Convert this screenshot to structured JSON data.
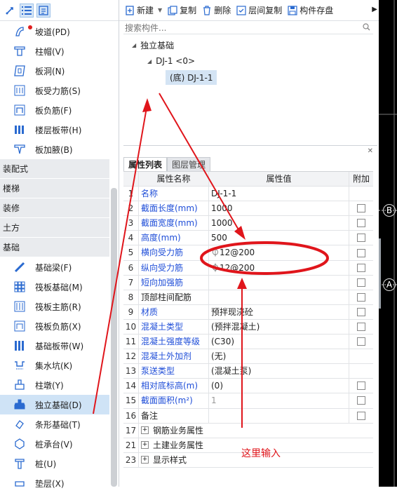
{
  "left_panel": {
    "items_top": [
      {
        "label": "坡道(PD)",
        "icon": "ramp-icon"
      },
      {
        "label": "柱帽(V)",
        "icon": "column-cap-icon"
      },
      {
        "label": "板洞(N)",
        "icon": "slab-hole-icon"
      },
      {
        "label": "板受力筋(S)",
        "icon": "slab-rebar-icon"
      },
      {
        "label": "板负筋(F)",
        "icon": "slab-negative-rebar-icon"
      },
      {
        "label": "楼层板带(H)",
        "icon": "floor-slab-strip-icon"
      },
      {
        "label": "板加腋(B)",
        "icon": "slab-haunch-icon"
      }
    ],
    "categories": [
      "装配式",
      "楼梯",
      "装修",
      "土方",
      "基础"
    ],
    "items_bottom": [
      {
        "label": "基础梁(F)",
        "icon": "foundation-beam-icon"
      },
      {
        "label": "筏板基础(M)",
        "icon": "raft-foundation-icon"
      },
      {
        "label": "筏板主筋(R)",
        "icon": "raft-main-rebar-icon"
      },
      {
        "label": "筏板负筋(X)",
        "icon": "raft-negative-rebar-icon"
      },
      {
        "label": "基础板带(W)",
        "icon": "foundation-strip-icon"
      },
      {
        "label": "集水坑(K)",
        "icon": "sump-pit-icon"
      },
      {
        "label": "柱墩(Y)",
        "icon": "column-pier-icon"
      },
      {
        "label": "独立基础(D)",
        "icon": "isolated-footing-icon",
        "selected": true
      },
      {
        "label": "条形基础(T)",
        "icon": "strip-footing-icon"
      },
      {
        "label": "桩承台(V)",
        "icon": "pile-cap-icon"
      },
      {
        "label": "桩(U)",
        "icon": "pile-icon"
      },
      {
        "label": "垫层(X)",
        "icon": "cushion-icon"
      }
    ]
  },
  "toolbar": {
    "new_label": "新建",
    "copy_label": "复制",
    "delete_label": "删除",
    "floor_copy_label": "层间复制",
    "store_label": "构件存盘"
  },
  "search": {
    "placeholder": "搜索构件..."
  },
  "tree": {
    "root": "独立基础",
    "child": "DJ-1 <0>",
    "leaf": "(底) DJ-1-1"
  },
  "props": {
    "tabs": [
      "属性列表",
      "图层管理"
    ],
    "headers": {
      "name": "属性名称",
      "value": "属性值",
      "extra": "附加"
    },
    "rows": [
      {
        "n": "1",
        "name": "名称",
        "value": "DJ-1-1",
        "blue": true,
        "check": false
      },
      {
        "n": "2",
        "name": "截面长度(mm)",
        "value": "1000",
        "blue": true,
        "check": true
      },
      {
        "n": "3",
        "name": "截面宽度(mm)",
        "value": "1000",
        "blue": true,
        "check": true
      },
      {
        "n": "4",
        "name": "高度(mm)",
        "value": "500",
        "blue": true,
        "check": true
      },
      {
        "n": "5",
        "name": "横向受力筋",
        "value": "⏀12@200",
        "blue": true,
        "check": true
      },
      {
        "n": "6",
        "name": "纵向受力筋",
        "value": "⏀12@200",
        "blue": true,
        "check": true
      },
      {
        "n": "7",
        "name": "短向加强筋",
        "value": "",
        "blue": true,
        "check": true
      },
      {
        "n": "8",
        "name": "顶部柱间配筋",
        "value": "",
        "blue": false,
        "check": true
      },
      {
        "n": "9",
        "name": "材质",
        "value": "预拌现浇砼",
        "blue": true,
        "check": true
      },
      {
        "n": "10",
        "name": "混凝土类型",
        "value": "(预拌混凝土)",
        "blue": true,
        "check": true
      },
      {
        "n": "11",
        "name": "混凝土强度等级",
        "value": "(C30)",
        "blue": true,
        "check": true
      },
      {
        "n": "12",
        "name": "混凝土外加剂",
        "value": "(无)",
        "blue": true,
        "check": false
      },
      {
        "n": "13",
        "name": "泵送类型",
        "value": "(混凝土泵)",
        "blue": true,
        "check": false
      },
      {
        "n": "14",
        "name": "相对底标高(m)",
        "value": "(0)",
        "blue": true,
        "check": true
      },
      {
        "n": "15",
        "name": "截面面积(m²)",
        "value": "1",
        "blue": true,
        "check": true,
        "gray_value": true
      },
      {
        "n": "16",
        "name": "备注",
        "value": "",
        "blue": false,
        "check": true
      }
    ],
    "groups": [
      {
        "n": "17",
        "label": "钢筋业务属性"
      },
      {
        "n": "21",
        "label": "土建业务属性"
      },
      {
        "n": "23",
        "label": "显示样式"
      }
    ]
  },
  "canvas": {
    "axis_labels": [
      "B",
      "A"
    ]
  },
  "annotation": {
    "text": "这里输入",
    "color": "#e0151b"
  }
}
